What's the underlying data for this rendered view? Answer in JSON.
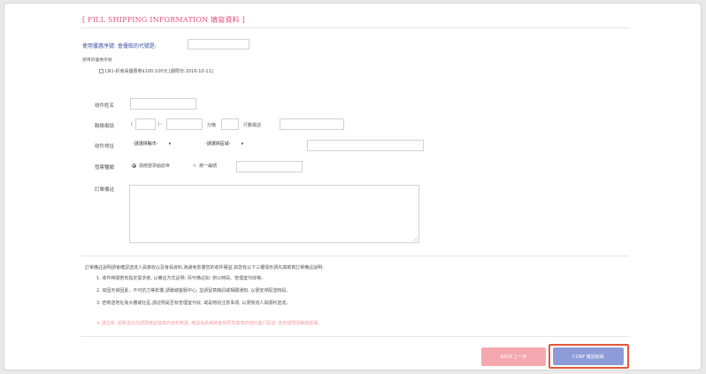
{
  "section": {
    "title": "[ FILL SHIPPING INFORMATION 填寫資料 ]"
  },
  "coupon": {
    "label": "使用優惠序號: 會優取的代號是:",
    "available_label": "使用的優惠序號",
    "item_text": "LN1-折會員優惠券$100:100元 [期限日:2016-10-11]"
  },
  "form": {
    "recipient_name_label": "收件姓名",
    "phone_label": "聯絡電話",
    "paren_open": "(",
    "paren_close": ") -",
    "ext_label": "分機",
    "mobile_label": "行動電話",
    "address_label": "收件地址",
    "city_select": "-請選擇縣市-",
    "district_select": "-請選擇區域-",
    "invoice_label": "發票種類",
    "invoice_option_1": "捐贈發票給創世",
    "invoice_option_2": "統一編號",
    "note_label": "訂單備註"
  },
  "notes": {
    "intro": "訂單備註說明請會確認送達人員簽收以及會員資料,為避免影響您的收件權益,如您有以下三種情形請先填寫寫訂單備註說明:",
    "items": [
      "1. 收件時間若有指定需求者, 以備註方式註明; 另可備註如: 辦公時段、管理室代收等。",
      "2. 如因天候因素、不可抗力等影響,請聯絡客服中心, 並請留意簡訊或相關通知, 以便安排配送時段。",
      "3. 若寄送地址為大樓或社區,請註明是否有管理室代收, 或是特別注意事項, 以便物流人員順利送達。"
    ],
    "warning": "※ 請注意: 點擊送出前請再確認填寫的資料無誤, 確認後系統將會依照您填寫的資料進行配送, 若有疑問請聯絡客服。"
  },
  "buttons": {
    "back_label": "BACK 上一步",
    "confirm_label": "CONF 確認結帳"
  },
  "colors": {
    "title": "#e0537a",
    "link": "#3a4fa0",
    "back_button": "#f5a7b0",
    "confirm_button": "#8d9bd8",
    "highlight_outline": "#e2583e"
  }
}
